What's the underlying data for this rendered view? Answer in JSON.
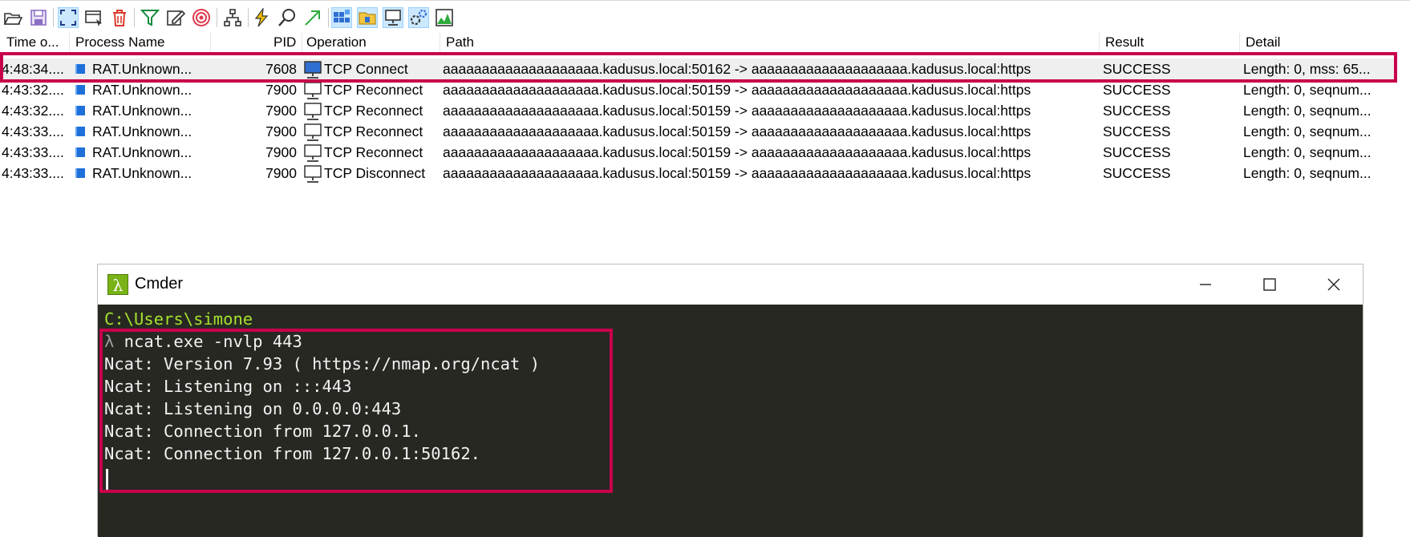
{
  "toolbar": {
    "buttons": [
      {
        "name": "open-icon"
      },
      {
        "name": "save-icon"
      },
      {
        "name": "autoscroll-icon"
      },
      {
        "name": "capture-icon"
      },
      {
        "name": "clear-icon"
      },
      {
        "name": "filter-icon"
      },
      {
        "name": "highlight-icon"
      },
      {
        "name": "target-icon"
      },
      {
        "name": "process-tree-icon"
      },
      {
        "name": "activity-icon"
      },
      {
        "name": "find-icon"
      },
      {
        "name": "jump-icon"
      },
      {
        "name": "registry-activity-icon"
      },
      {
        "name": "file-activity-icon"
      },
      {
        "name": "network-activity-icon"
      },
      {
        "name": "process-activity-icon"
      },
      {
        "name": "profiling-activity-icon"
      }
    ]
  },
  "table": {
    "columns": [
      "Time o...",
      "Process Name",
      "PID",
      "Operation",
      "Path",
      "Result",
      "Detail"
    ],
    "rows": [
      {
        "time": "4:48:34....",
        "process": "RAT.Unknown...",
        "pid": "7608",
        "operation": "TCP Connect",
        "path": "aaaaaaaaaaaaaaaaaaaa.kadusus.local:50162 -> aaaaaaaaaaaaaaaaaaaa.kadusus.local:https",
        "result": "SUCCESS",
        "detail": "Length: 0, mss: 65..."
      },
      {
        "time": "4:43:32....",
        "process": "RAT.Unknown...",
        "pid": "7900",
        "operation": "TCP Reconnect",
        "path": "aaaaaaaaaaaaaaaaaaaa.kadusus.local:50159 -> aaaaaaaaaaaaaaaaaaaa.kadusus.local:https",
        "result": "SUCCESS",
        "detail": "Length: 0, seqnum..."
      },
      {
        "time": "4:43:32....",
        "process": "RAT.Unknown...",
        "pid": "7900",
        "operation": "TCP Reconnect",
        "path": "aaaaaaaaaaaaaaaaaaaa.kadusus.local:50159 -> aaaaaaaaaaaaaaaaaaaa.kadusus.local:https",
        "result": "SUCCESS",
        "detail": "Length: 0, seqnum..."
      },
      {
        "time": "4:43:33....",
        "process": "RAT.Unknown...",
        "pid": "7900",
        "operation": "TCP Reconnect",
        "path": "aaaaaaaaaaaaaaaaaaaa.kadusus.local:50159 -> aaaaaaaaaaaaaaaaaaaa.kadusus.local:https",
        "result": "SUCCESS",
        "detail": "Length: 0, seqnum..."
      },
      {
        "time": "4:43:33....",
        "process": "RAT.Unknown...",
        "pid": "7900",
        "operation": "TCP Reconnect",
        "path": "aaaaaaaaaaaaaaaaaaaa.kadusus.local:50159 -> aaaaaaaaaaaaaaaaaaaa.kadusus.local:https",
        "result": "SUCCESS",
        "detail": "Length: 0, seqnum..."
      },
      {
        "time": "4:43:33....",
        "process": "RAT.Unknown...",
        "pid": "7900",
        "operation": "TCP Disconnect",
        "path": "aaaaaaaaaaaaaaaaaaaa.kadusus.local:50159 -> aaaaaaaaaaaaaaaaaaaa.kadusus.local:https",
        "result": "SUCCESS",
        "detail": "Length: 0, seqnum..."
      }
    ]
  },
  "cmder": {
    "title": "Cmder",
    "badge": "λ",
    "path_line": "C:\\Users\\simone",
    "prompt_symbol": "λ",
    "command": " ncat.exe -nvlp 443",
    "output": [
      "Ncat: Version 7.93 ( https://nmap.org/ncat )",
      "Ncat: Listening on :::443",
      "Ncat: Listening on 0.0.0.0:443",
      "Ncat: Connection from 127.0.0.1.",
      "Ncat: Connection from 127.0.0.1:50162."
    ]
  },
  "colors": {
    "highlight": "#c8004b",
    "console_bg": "#272822",
    "console_path": "#a6e22e"
  }
}
